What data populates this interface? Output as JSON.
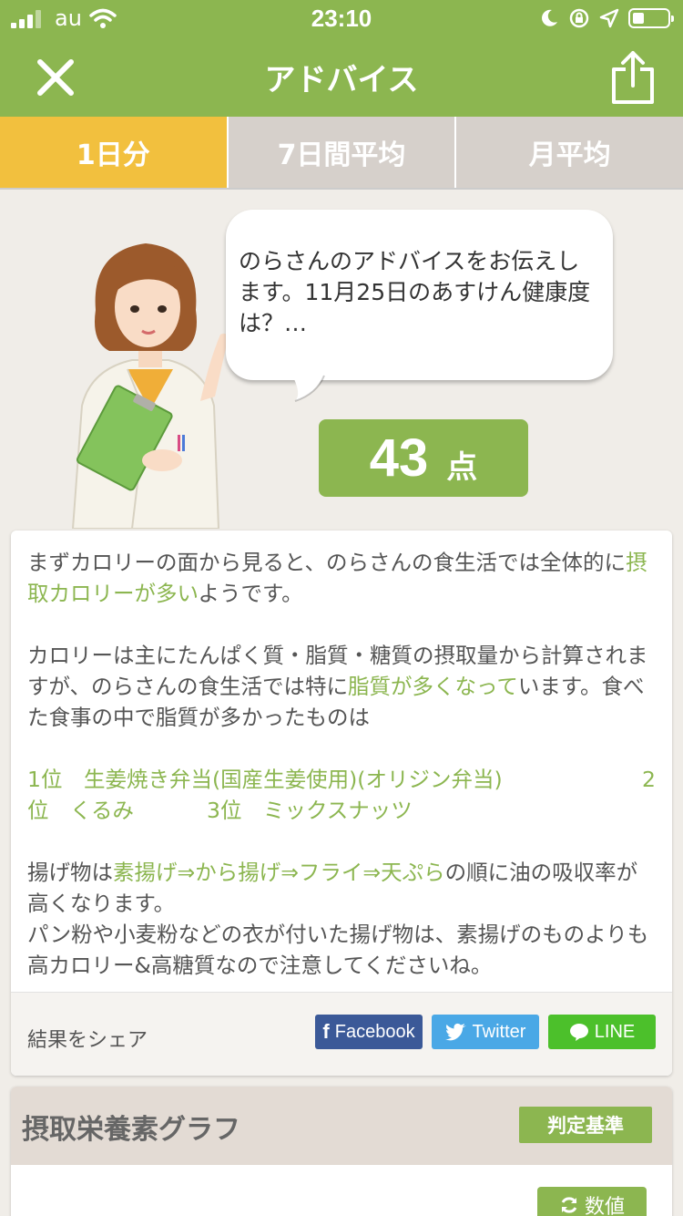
{
  "status_bar": {
    "carrier": "au",
    "time": "23:10"
  },
  "nav": {
    "title": "アドバイス"
  },
  "tabs": [
    {
      "label": "1日分",
      "active": true
    },
    {
      "label": "7日間平均",
      "active": false
    },
    {
      "label": "月平均",
      "active": false
    }
  ],
  "advice": {
    "bubble_text": "のらさんのアドバイスをお伝えします。11月25日のあすけん健康度は？…",
    "score": {
      "value": "43",
      "unit": "点"
    }
  },
  "card": {
    "p1": {
      "pre": "まずカロリーの面から見ると、のらさんの食生活では全体的に",
      "hl": "摂取カロリーが多い",
      "post": "ようです。"
    },
    "p2": {
      "pre": "カロリーは主にたんぱく質・脂質・糖質の摂取量から計算されますが、のらさんの食生活では特に",
      "hl": "脂質が多くなって",
      "post": "います。食べた食事の中で脂質が多かったものは"
    },
    "ranks": {
      "r1": "1位　生姜焼き弁当(国産生姜使用)(オリジン弁当)",
      "r2a": "2",
      "r2b": "位　くるみ",
      "r3": "3位　ミックスナッツ"
    },
    "p3": {
      "pre": "揚げ物は",
      "hl": "素揚げ⇒から揚げ⇒フライ⇒天ぷら",
      "post": "の順に油の吸収率が高くなります。"
    },
    "p4": "パン粉や小麦粉などの衣が付いた揚げ物は、素揚げのものよりも高カロリー&高糖質なので注意してくださいね。",
    "share": {
      "label": "結果をシェア",
      "facebook": "Facebook",
      "twitter": "Twitter",
      "line": "LINE"
    }
  },
  "graph": {
    "title": "摂取栄養素グラフ",
    "criteria_button": "判定基準",
    "value_button": "数値"
  },
  "colors": {
    "brand_green": "#8cb650",
    "tab_active": "#f2c03e",
    "tab_inactive": "#d6d0cb",
    "facebook": "#3b5998",
    "twitter": "#4aa8e6",
    "line": "#4cc02b"
  }
}
